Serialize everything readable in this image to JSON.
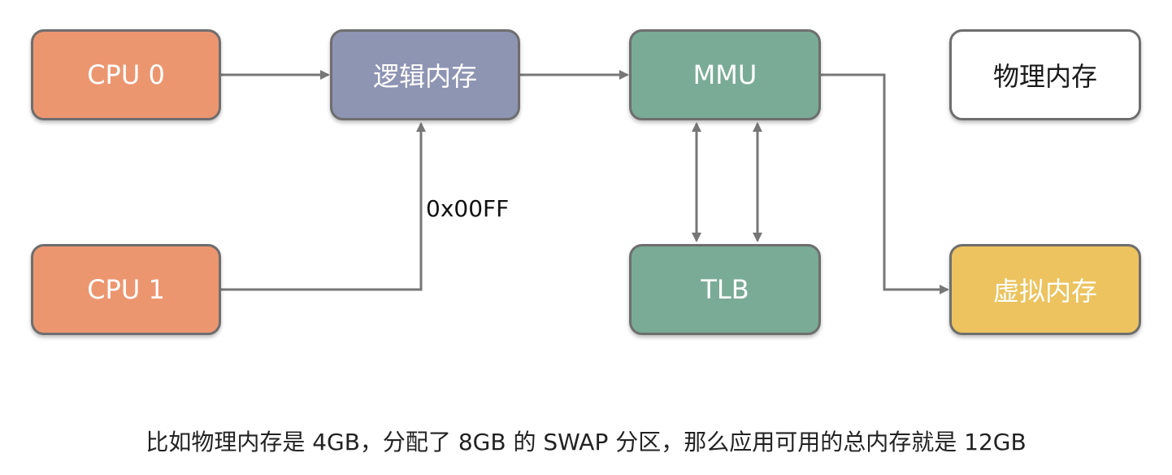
{
  "nodes": {
    "cpu0": "CPU 0",
    "cpu1": "CPU 1",
    "logical_memory": "逻辑内存",
    "mmu": "MMU",
    "tlb": "TLB",
    "physical_memory": "物理内存",
    "virtual_memory": "虚拟内存"
  },
  "edge_label": "0x00FF",
  "caption": "比如物理内存是 4GB，分配了 8GB 的 SWAP 分区，那么应用可用的总内存就是 12GB",
  "colors": {
    "cpu": "#ec9670",
    "logical_memory": "#8e95b3",
    "mmu_tlb": "#7aab97",
    "physical_memory": "#ffffff",
    "virtual_memory": "#ecc35f",
    "connector": "#777777"
  }
}
